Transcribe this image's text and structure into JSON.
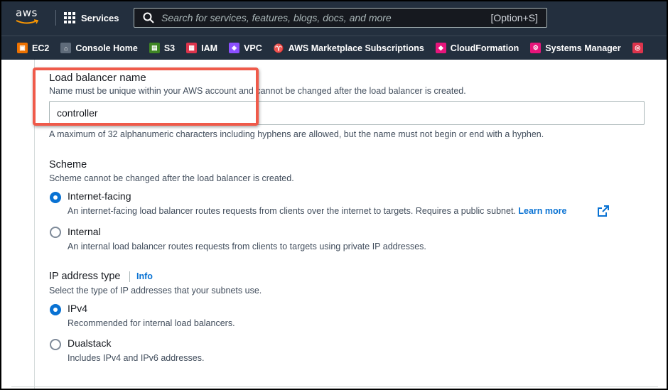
{
  "nav": {
    "logo": "aws",
    "services_label": "Services",
    "search_placeholder": "Search for services, features, blogs, docs, and more",
    "search_shortcut": "[Option+S]"
  },
  "favorites": [
    {
      "label": "EC2",
      "color": "#ed7100",
      "icon": "ec2-icon"
    },
    {
      "label": "Console Home",
      "color": "#5f6b7a",
      "icon": "console-home-icon"
    },
    {
      "label": "S3",
      "color": "#3f8624",
      "icon": "s3-icon"
    },
    {
      "label": "IAM",
      "color": "#dd344c",
      "icon": "iam-icon"
    },
    {
      "label": "VPC",
      "color": "#8c4fff",
      "icon": "vpc-icon"
    },
    {
      "label": "AWS Marketplace Subscriptions",
      "color": "#232f3e",
      "icon": "marketplace-icon"
    },
    {
      "label": "CloudFormation",
      "color": "#e7157b",
      "icon": "cloudformation-icon"
    },
    {
      "label": "Systems Manager",
      "color": "#e7157b",
      "icon": "systems-manager-icon"
    }
  ],
  "lb_name": {
    "title": "Load balancer name",
    "description": "Name must be unique within your AWS account and cannot be changed after the load balancer is created.",
    "value": "controller",
    "constraint": "A maximum of 32 alphanumeric characters including hyphens are allowed, but the name must not begin or end with a hyphen."
  },
  "scheme": {
    "title": "Scheme",
    "description": "Scheme cannot be changed after the load balancer is created.",
    "options": [
      {
        "label": "Internet-facing",
        "description": "An internet-facing load balancer routes requests from clients over the internet to targets. Requires a public subnet.",
        "link": "Learn more",
        "selected": true
      },
      {
        "label": "Internal",
        "description": "An internal load balancer routes requests from clients to targets using private IP addresses.",
        "selected": false
      }
    ]
  },
  "ip_type": {
    "title": "IP address type",
    "info": "Info",
    "description": "Select the type of IP addresses that your subnets use.",
    "options": [
      {
        "label": "IPv4",
        "description": "Recommended for internal load balancers.",
        "selected": true
      },
      {
        "label": "Dualstack",
        "description": "Includes IPv4 and IPv6 addresses.",
        "selected": false
      }
    ]
  },
  "colors": {
    "nav_bg": "#232f3e",
    "accent": "#0972d3",
    "highlight": "#ef5a4a"
  }
}
